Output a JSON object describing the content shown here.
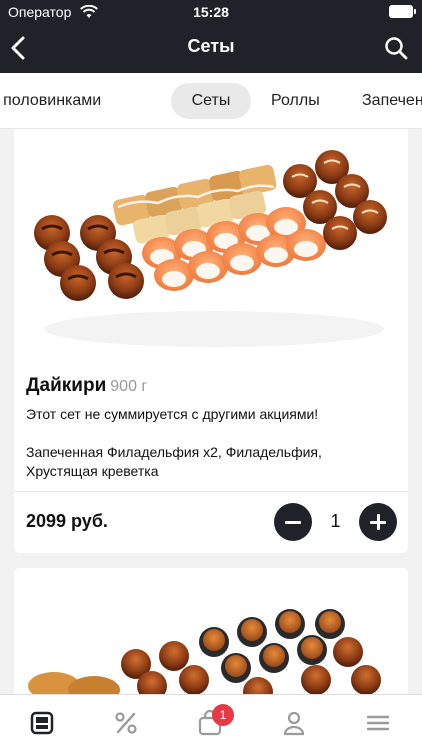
{
  "status_bar": {
    "carrier": "Оператор",
    "time": "15:28"
  },
  "header": {
    "title": "Сеты"
  },
  "categories": [
    {
      "label": "Роллы половинками"
    },
    {
      "label": "Сеты",
      "active": true
    },
    {
      "label": "Роллы"
    },
    {
      "label": "Запеченные"
    }
  ],
  "products": [
    {
      "name": "Дайкири",
      "weight": "900 г",
      "note": "Этот сет не суммируется с другими акциями!",
      "description": "Запеченная Филадельфия x2, Филадельфия, Хрустящая креветка",
      "price": "2099 руб.",
      "quantity": "1"
    }
  ],
  "bottom_nav": {
    "cart_count": "1"
  },
  "colors": {
    "dark": "#1f2229",
    "badge": "#e63946",
    "active_tab": "#e9e9e9"
  },
  "icons": [
    "back-arrow-icon",
    "search-icon",
    "menu-icon",
    "discount-icon",
    "cart-icon",
    "profile-icon",
    "hamburger-icon"
  ]
}
